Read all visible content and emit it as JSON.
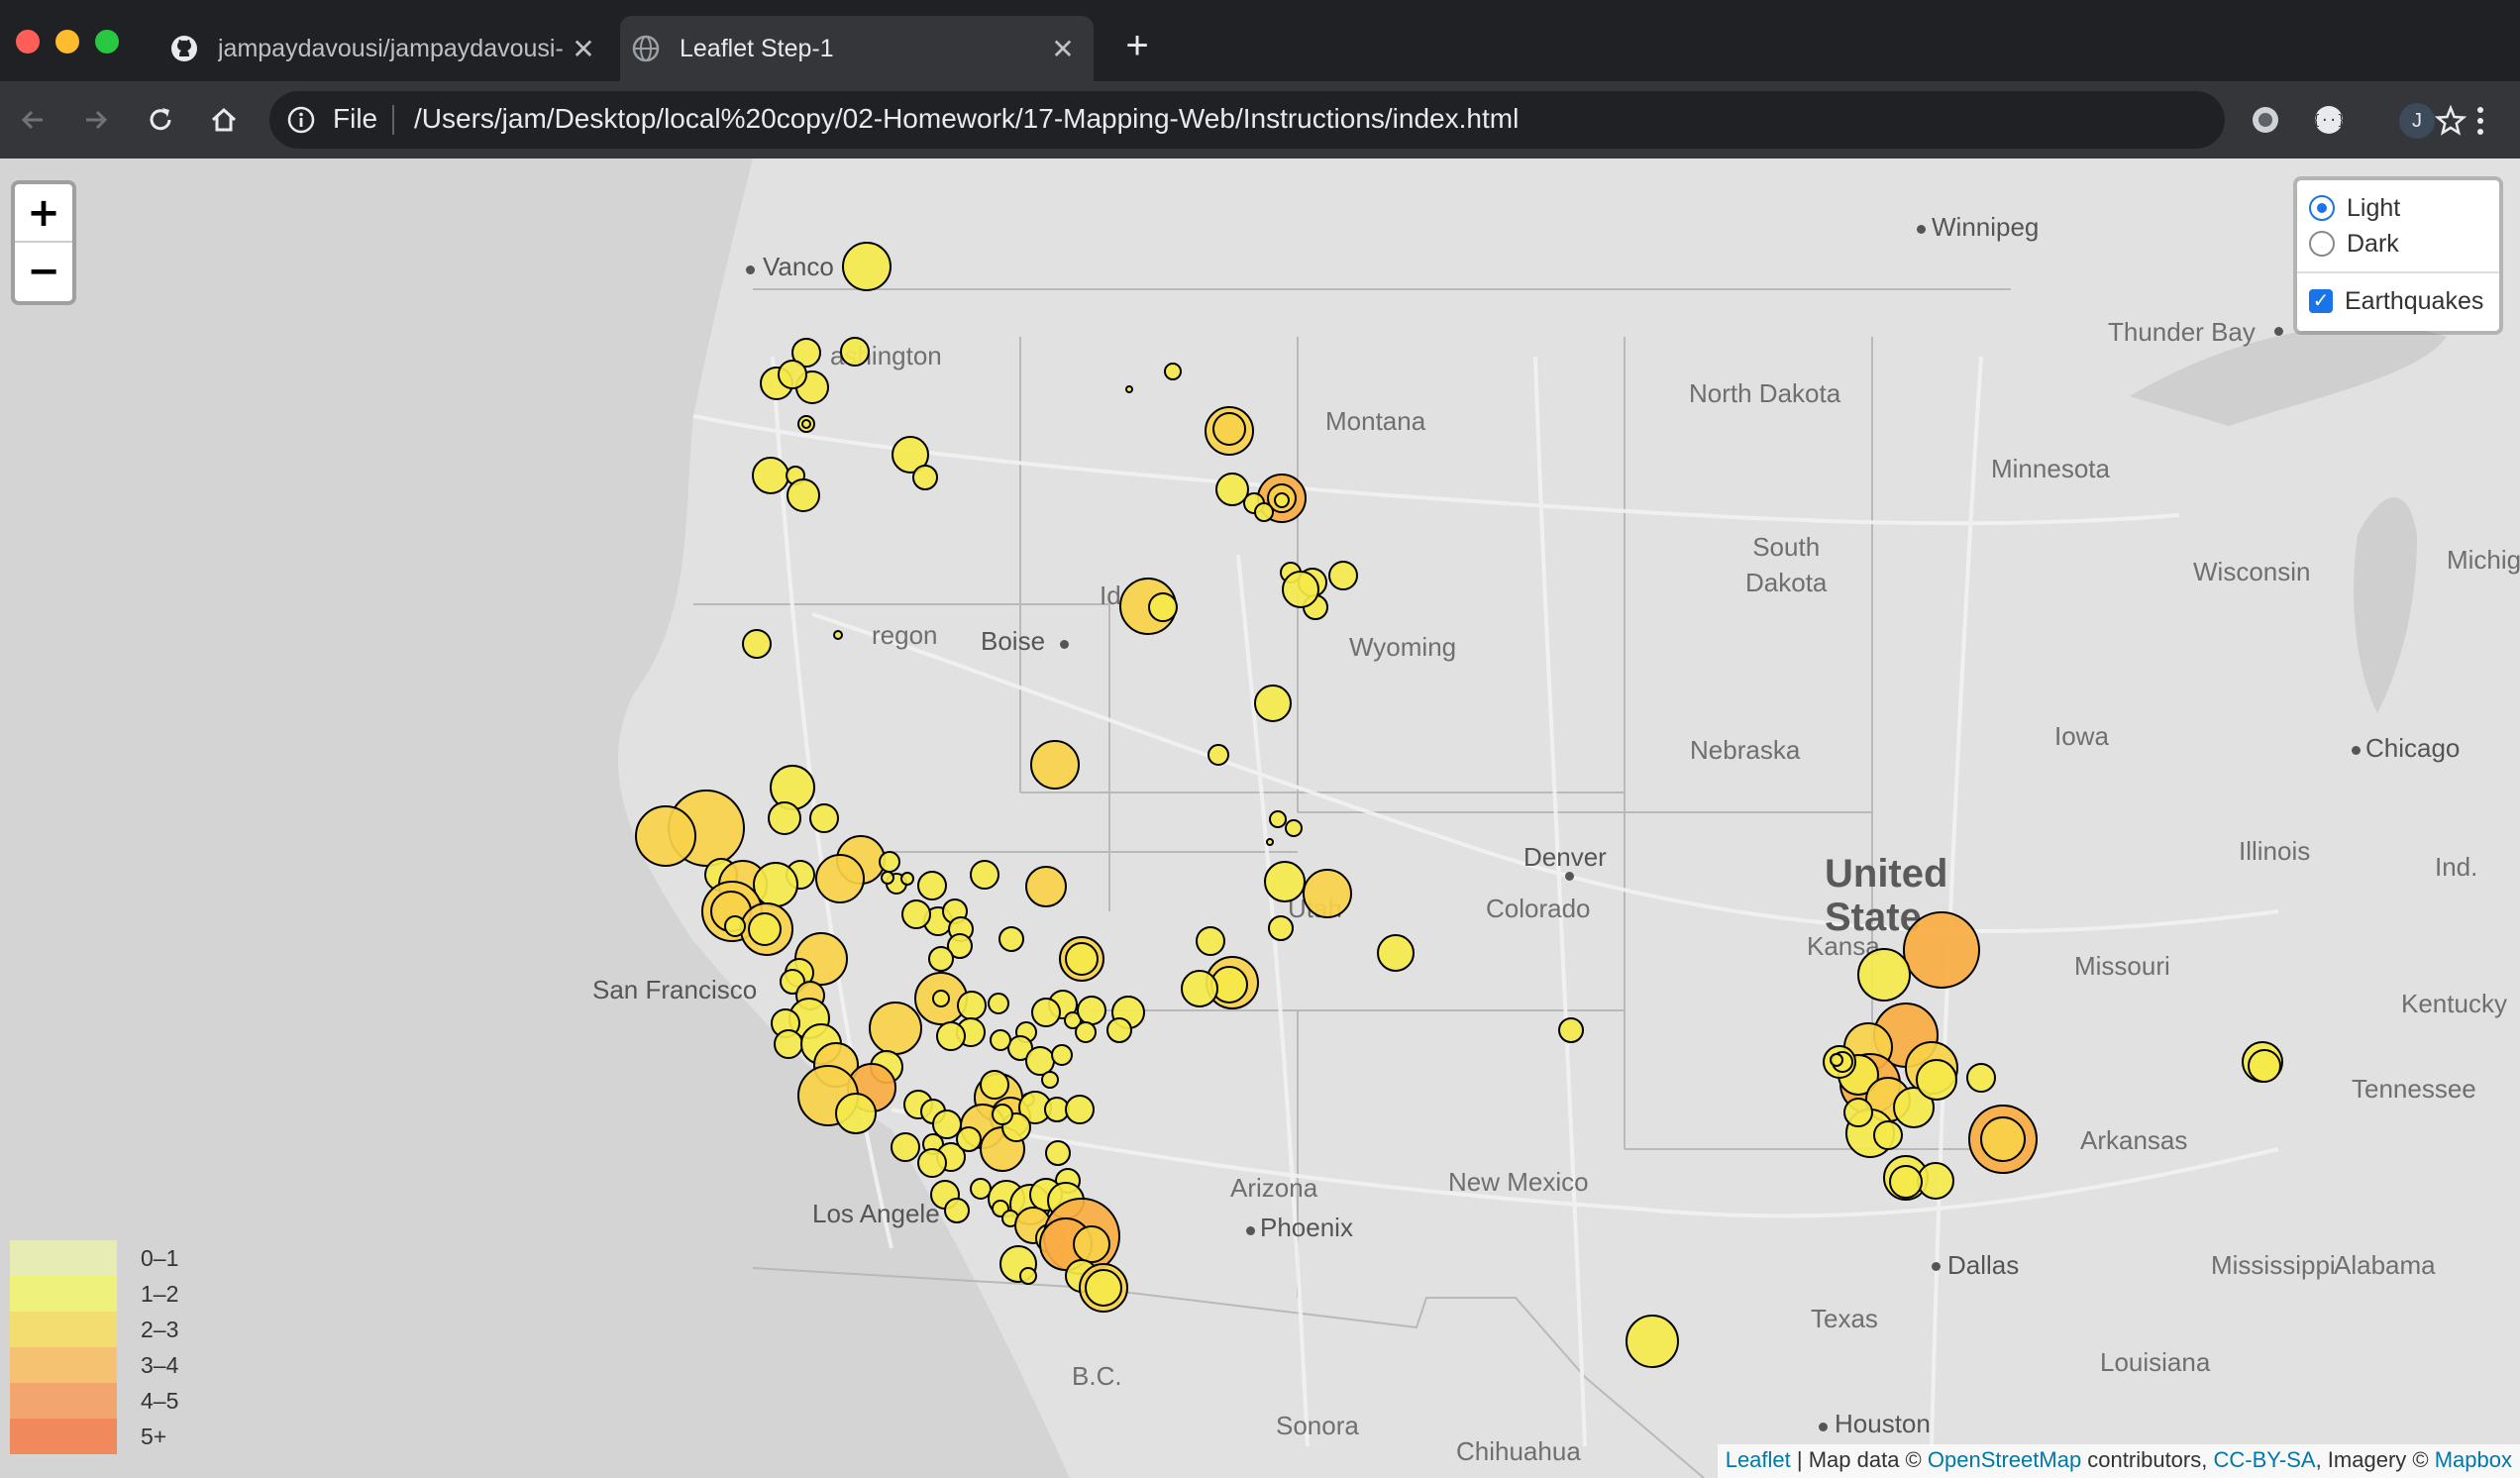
{
  "browser": {
    "tabs": [
      {
        "title": "jampaydavousi/jampaydavousi-",
        "icon": "github-icon",
        "active": false
      },
      {
        "title": "Leaflet Step-1",
        "icon": "globe-icon",
        "active": true
      }
    ],
    "new_tab_label": "+",
    "address": {
      "scheme_label": "File",
      "url": "/Users/jam/Desktop/local%20copy/02-Homework/17-Mapping-Web/Instructions/index.html"
    },
    "profile_initial": "J"
  },
  "map": {
    "zoom": {
      "in_label": "+",
      "out_label": "−"
    },
    "layers": {
      "base": [
        {
          "label": "Light",
          "selected": true
        },
        {
          "label": "Dark",
          "selected": false
        }
      ],
      "overlays": [
        {
          "label": "Earthquakes",
          "checked": true
        }
      ]
    },
    "labels": {
      "vancouver": "Vanco",
      "washington": "ashington",
      "montana": "Montana",
      "north_dakota": "North Dakota",
      "winnipeg": "Winnipeg",
      "thunder_bay": "Thunder Bay",
      "minnesota": "Minnesota",
      "south_dakota": "South\nDakota",
      "wisconsin": "Wisconsin",
      "michigan": "Michiga",
      "oregon": "regon",
      "boise": "Boise",
      "id": "Id",
      "wyoming": "Wyoming",
      "nebraska": "Nebraska",
      "iowa": "Iowa",
      "chicago": "Chicago",
      "illinois": "Illinois",
      "ind": "Ind.",
      "denver": "Denver",
      "colorado": "Colorado",
      "utah": "Utah",
      "kansas": "Kansa",
      "missouri": "Missouri",
      "kentucky": "Kentucky",
      "san_francisco": "San Francisco",
      "tennessee": "Tennessee",
      "arkansas": "Arkansas",
      "los_angeles": "Los Angele",
      "arizona": "Arizona",
      "phoenix": "Phoenix",
      "new_mexico": "New Mexico",
      "dallas": "Dallas",
      "mississippi": "Mississippi",
      "alabama": "Alabama",
      "texas": "Texas",
      "louisiana": "Louisiana",
      "houston": "Houston",
      "bc": "B.C.",
      "sonora": "Sonora",
      "chihuahua": "Chihuahua",
      "united_states": "United\nState"
    },
    "legend": [
      {
        "label": "0–1",
        "color": "#e6ecb4"
      },
      {
        "label": "1–2",
        "color": "#eef27a"
      },
      {
        "label": "2–3",
        "color": "#f3dd6e"
      },
      {
        "label": "3–4",
        "color": "#f4c270"
      },
      {
        "label": "4–5",
        "color": "#f3a56e"
      },
      {
        "label": "5+",
        "color": "#f08a5d"
      }
    ],
    "attribution": {
      "leaflet": "Leaflet",
      "sep1": " | Map data © ",
      "osm": "OpenStreetMap",
      "mid": " contributors, ",
      "license": "CC-BY-SA",
      "imagery": ", Imagery © ",
      "mapbox": "Mapbox"
    },
    "marker_colors": {
      "yellow": "#f5e94a",
      "gold": "#f8d14a",
      "orange": "#f8ac42"
    }
  }
}
